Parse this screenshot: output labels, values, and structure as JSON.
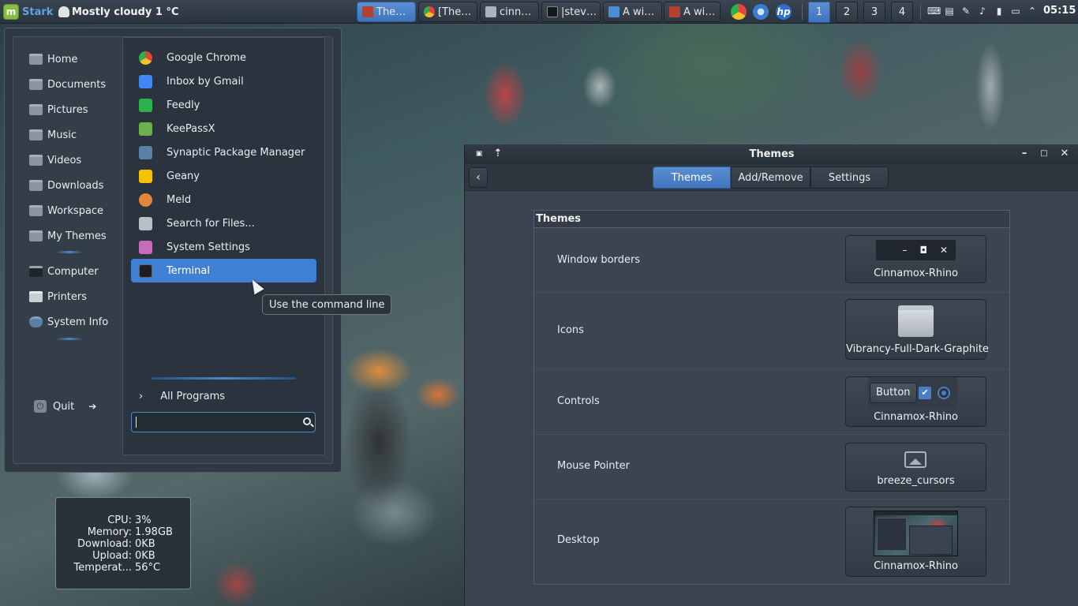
{
  "panel": {
    "menu_label": "Stark",
    "weather": "Mostly cloudy 1 °C",
    "tasks": [
      {
        "label": "The…",
        "active": true
      },
      {
        "label": "[The…",
        "active": false
      },
      {
        "label": "cinn…",
        "active": false
      },
      {
        "label": "|stev…",
        "active": false
      },
      {
        "label": "A wi…",
        "active": false
      },
      {
        "label": "A wi…",
        "active": false
      }
    ],
    "tray_apps": [
      "chrome-icon",
      "network-globe-icon",
      "hp-icon"
    ],
    "hp_label": "hp",
    "workspaces": [
      "1",
      "2",
      "3",
      "4"
    ],
    "active_workspace": "1",
    "clock": "05:15"
  },
  "menu": {
    "places": [
      {
        "label": "Home",
        "icon": "home-folder-icon"
      },
      {
        "label": "Documents",
        "icon": "documents-folder-icon"
      },
      {
        "label": "Pictures",
        "icon": "pictures-folder-icon"
      },
      {
        "label": "Music",
        "icon": "music-folder-icon"
      },
      {
        "label": "Videos",
        "icon": "videos-folder-icon"
      },
      {
        "label": "Downloads",
        "icon": "downloads-folder-icon"
      },
      {
        "label": "Workspace",
        "icon": "folder-icon"
      },
      {
        "label": "My Themes",
        "icon": "folder-icon"
      }
    ],
    "system": [
      {
        "label": "Computer",
        "icon": "computer-icon"
      },
      {
        "label": "Printers",
        "icon": "printer-icon"
      },
      {
        "label": "System Info",
        "icon": "gear-icon"
      }
    ],
    "quit_label": "Quit",
    "apps": [
      {
        "label": "Google Chrome",
        "icon": "chrome-icon",
        "color": "#e7453a"
      },
      {
        "label": "Inbox by Gmail",
        "icon": "inbox-icon",
        "color": "#4285f4"
      },
      {
        "label": "Feedly",
        "icon": "feedly-icon",
        "color": "#2bb24c"
      },
      {
        "label": "KeePassX",
        "icon": "keepassx-icon",
        "color": "#6ab04c"
      },
      {
        "label": "Synaptic Package Manager",
        "icon": "synaptic-icon",
        "color": "#5b7fa6"
      },
      {
        "label": "Geany",
        "icon": "geany-icon",
        "color": "#f5c400"
      },
      {
        "label": "Meld",
        "icon": "meld-icon",
        "color": "#e2873c"
      },
      {
        "label": "Search for Files...",
        "icon": "search-files-icon",
        "color": "#b8bfc6"
      },
      {
        "label": "System Settings",
        "icon": "settings-icon",
        "color": "#c86bb8"
      },
      {
        "label": "Terminal",
        "icon": "terminal-icon",
        "color": "#1b1f23"
      }
    ],
    "selected_app": "Terminal",
    "all_programs_label": "All Programs",
    "search_value": "",
    "tooltip": "Use the command line"
  },
  "sysmon": {
    "rows": [
      {
        "label": "CPU:",
        "value": "3%"
      },
      {
        "label": "Memory:",
        "value": "1.98GB"
      },
      {
        "label": "Download:",
        "value": "0KB"
      },
      {
        "label": "Upload:",
        "value": "0KB"
      },
      {
        "label": "Temperat...",
        "value": "56°C"
      }
    ]
  },
  "themes_window": {
    "title": "Themes",
    "tabs": [
      "Themes",
      "Add/Remove",
      "Settings"
    ],
    "active_tab": "Themes",
    "section_header": "Themes",
    "rows": [
      {
        "label": "Window borders",
        "value": "Cinnamox-Rhino"
      },
      {
        "label": "Icons",
        "value": "Vibrancy-Full-Dark-Graphite"
      },
      {
        "label": "Controls",
        "value": "Cinnamox-Rhino"
      },
      {
        "label": "Mouse Pointer",
        "value": "breeze_cursors"
      },
      {
        "label": "Desktop",
        "value": "Cinnamox-Rhino"
      }
    ],
    "controls_preview_button": "Button"
  },
  "colors": {
    "accent": "#4080d4",
    "panel_bg": "#2b343e",
    "window_bg": "#3a4451"
  }
}
